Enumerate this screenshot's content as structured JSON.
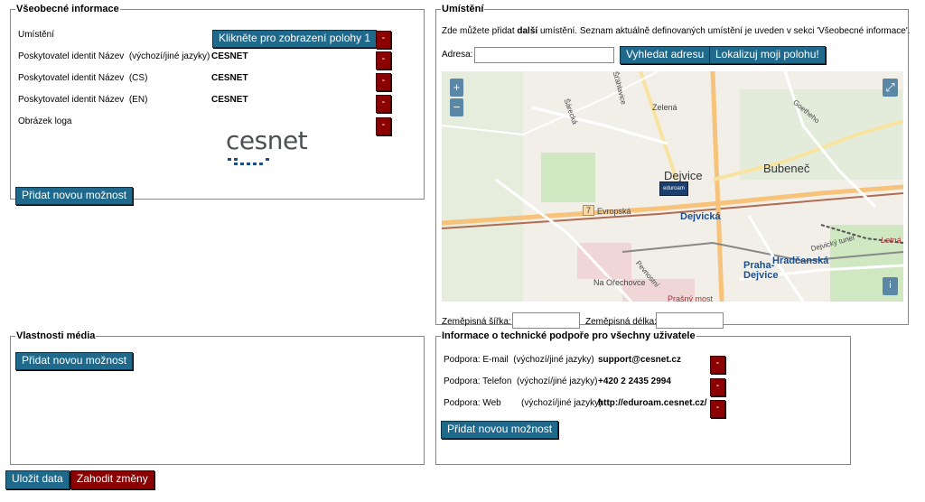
{
  "general": {
    "legend": "Všeobecné informace",
    "location_label": "Umístění",
    "show_location_button": "Klikněte pro zobrazení polohy 1",
    "rows": [
      {
        "label": "Poskytovatel identit Název",
        "lang": "(výchozí/jiné jazyky)",
        "value": "CESNET"
      },
      {
        "label": "Poskytovatel identit Název",
        "lang": "(CS)",
        "value": "CESNET"
      },
      {
        "label": "Poskytovatel identit Název",
        "lang": "(EN)",
        "value": "CESNET"
      }
    ],
    "logo_label": "Obrázek loga",
    "logo_text": "cesnet",
    "add_option": "Přidat novou možnost",
    "remove": "-"
  },
  "location": {
    "legend": "Umístění",
    "intro_pre": "Zde můžete přidat ",
    "intro_bold": "další",
    "intro_post": " umístění. Seznam aktuálně definovaných umístění je uveden v sekci 'Všeobecné informace'.",
    "address_label": "Adresa:",
    "address_value": "",
    "search_button": "Vyhledat adresu",
    "locate_button": "Lokalizuj moji polohu!",
    "latitude_label": "Zeměpisná šířka:",
    "longitude_label": "Zeměpisná délka:",
    "latitude_value": "",
    "longitude_value": "",
    "map": {
      "zoom_in": "+",
      "zoom_out": "−",
      "fullscreen": "⤢",
      "info": "i",
      "marker": "eduroam",
      "labels": {
        "dejvice": "Dejvice",
        "bubenec": "Bubeneč",
        "dejvicka": "Dejvická",
        "evropska": "Evropská",
        "zelena": "Zelená",
        "hradcanska": "Hradčanská",
        "praha_dejvice": "Praha-Dejvice",
        "na_orechovce": "Na Ořechovce",
        "prasny_most": "Prašný most",
        "route": "7",
        "sarecka": "Šárecká",
        "stahlavova": "Šťáhlavice",
        "goetheho": "Goetheho",
        "letna": "Letná",
        "dejvicky_tunel": "Dejvický tunel",
        "pevnostni": "Pevnostní"
      }
    }
  },
  "media": {
    "legend": "Vlastnosti média",
    "add_option": "Přidat novou možnost"
  },
  "support": {
    "legend": "Informace o technické podpoře pro všechny uživatele",
    "rows": [
      {
        "label": "Podpora: E-mail",
        "lang": "(výchozí/jiné jazyky)",
        "value": "support@cesnet.cz"
      },
      {
        "label": "Podpora: Telefon",
        "lang": "(výchozí/jiné jazyky)",
        "value": "+420 2 2435 2994"
      },
      {
        "label": "Podpora: Web",
        "lang": "(výchozí/jiné jazyky)",
        "value": "http://eduroam.cesnet.cz/"
      }
    ],
    "add_option": "Přidat novou možnost",
    "remove": "-"
  },
  "footer": {
    "save": "Uložit data",
    "discard": "Zahodit změny"
  },
  "colors": {
    "button_blue": "#1f6a8c",
    "button_red": "#8b0000"
  }
}
